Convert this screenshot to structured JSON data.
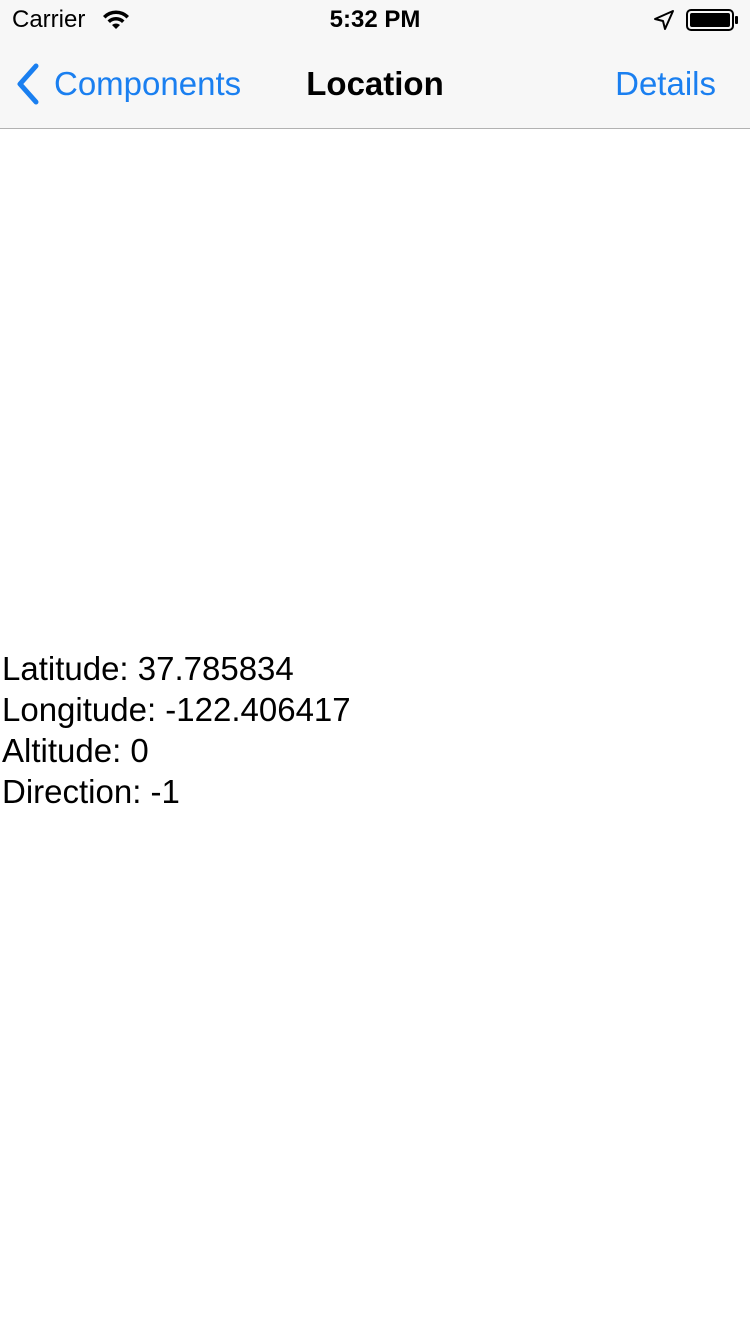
{
  "status_bar": {
    "carrier": "Carrier",
    "time": "5:32 PM",
    "icons": [
      "wifi-icon",
      "location-arrow-icon",
      "battery-icon"
    ]
  },
  "nav": {
    "back_label": "Components",
    "back_icon": "chevron-left-icon",
    "title": "Location",
    "right_label": "Details",
    "accent_color": "#1a7ff0"
  },
  "location": {
    "latitude": "Latitude: 37.785834",
    "longitude": "Longitude: -122.406417",
    "altitude": "Altitude: 0",
    "direction": "Direction: -1"
  }
}
